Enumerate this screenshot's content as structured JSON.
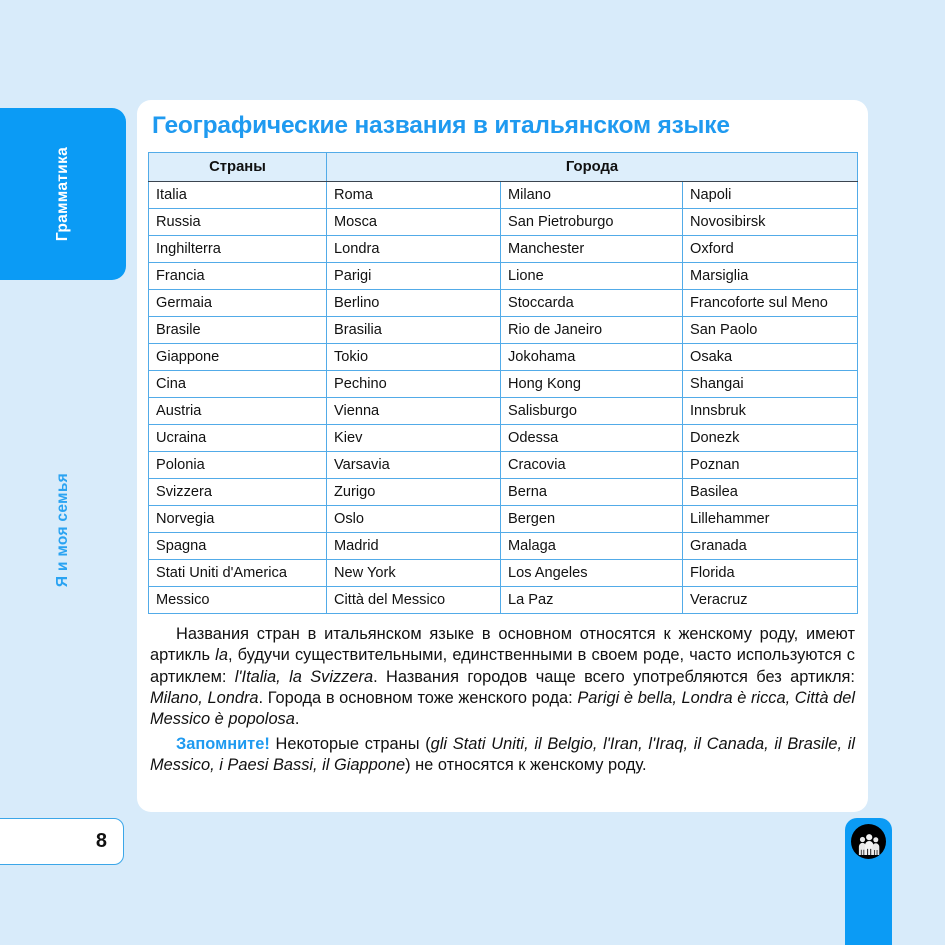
{
  "page": {
    "number": "8",
    "background_color": "#d8ebfa",
    "accent_color": "#1f9af0",
    "tab_color": "#0b9bf5"
  },
  "sidebar": {
    "tabs": [
      {
        "label": "Грамматика",
        "state": "active"
      },
      {
        "label": "Я и моя семья",
        "state": "inactive"
      }
    ]
  },
  "right_tab": {
    "icon_name": "family-icon"
  },
  "content": {
    "title": "Географические названия в итальянском языке",
    "table": {
      "headers": [
        "Страны",
        "Города"
      ],
      "rows": [
        [
          "Italia",
          "Roma",
          "Milano",
          "Napoli"
        ],
        [
          "Russia",
          "Mosca",
          "San Pietroburgo",
          "Novosibirsk"
        ],
        [
          "Inghilterra",
          "Londra",
          "Manchester",
          "Oxford"
        ],
        [
          "Francia",
          "Parigi",
          "Lione",
          "Marsiglia"
        ],
        [
          "Germaia",
          "Berlino",
          "Stoccarda",
          "Francoforte sul Meno"
        ],
        [
          "Brasile",
          "Brasilia",
          "Rio de Janeiro",
          "San Paolo"
        ],
        [
          "Giappone",
          "Tokio",
          "Jokohama",
          "Osaka"
        ],
        [
          "Cina",
          "Pechino",
          "Hong Kong",
          "Shangai"
        ],
        [
          "Austria",
          "Vienna",
          "Salisburgo",
          "Innsbruk"
        ],
        [
          "Ucraina",
          "Kiev",
          "Odessa",
          "Donezk"
        ],
        [
          "Polonia",
          "Varsavia",
          "Cracovia",
          "Poznan"
        ],
        [
          "Svizzera",
          "Zurigo",
          "Berna",
          "Basilea"
        ],
        [
          "Norvegia",
          "Oslo",
          "Bergen",
          "Lillehammer"
        ],
        [
          "Spagna",
          "Madrid",
          "Malaga",
          "Granada"
        ],
        [
          "Stati Uniti d'America",
          "New York",
          "Los Angeles",
          "Florida"
        ],
        [
          "Messico",
          "Città del Messico",
          "La Paz",
          "Veracruz"
        ]
      ]
    },
    "paragraph1": {
      "s1": "Названия стран в итальянском языке в основном относятся к женскому роду, имеют артикль ",
      "i1": "la",
      "s2": ", будучи существительными, единственными в своем роде, часто используются с артиклем: ",
      "i2": "l'Italia, la Svizzera",
      "s3": ". Названия городов чаще всего употребляются без артикля: ",
      "i3": "Milano, Londra",
      "s4": ". Города в основном тоже женского рода: ",
      "i4": "Parigi è bella, Londra è ricca, Città del Messico è popolosa",
      "s5": "."
    },
    "paragraph2": {
      "lead": "Запомните!",
      "s1": " Некоторые страны (",
      "i1": "gli Stati Uniti, il Belgio, l'Iran, l'Iraq, il Canada, il Brasile, il Messico, i Paesi Bassi, il Giappone",
      "s2": ") не относятся к женскому роду."
    }
  }
}
